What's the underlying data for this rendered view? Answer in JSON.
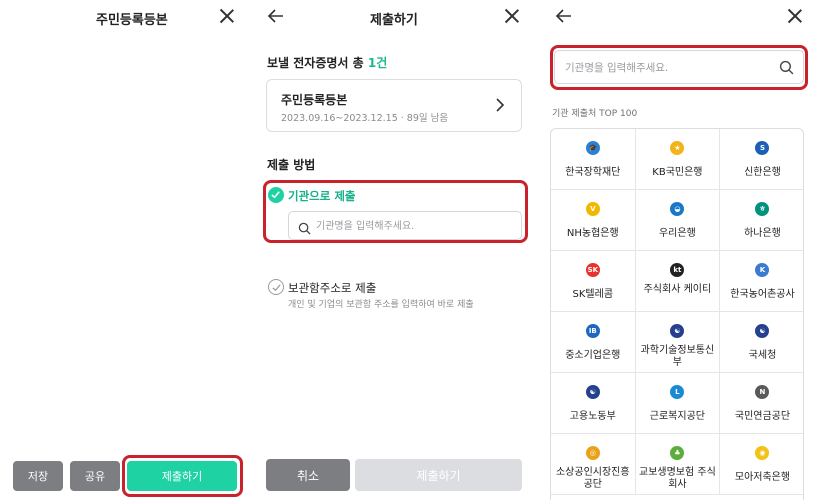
{
  "panel1": {
    "title": "주민등록등본",
    "buttons": {
      "save": "저장",
      "share": "공유",
      "submit": "제출하기"
    }
  },
  "panel2": {
    "title": "제출하기",
    "heading_prefix": "보낼 전자증명서 총 ",
    "heading_count": "1건",
    "doc": {
      "title": "주민등록등본",
      "subtitle": "2023.09.16~2023.12.15 · 89일 남음"
    },
    "method_heading": "제출 방법",
    "option_agency": {
      "label": "기관으로 제출",
      "checked": true
    },
    "search": {
      "placeholder": "기관명을 입력해주세요."
    },
    "option_box": {
      "label": "보관함주소로 제출",
      "desc": "개인 및 기업의 보관함 주소를 입력하여 바로 제출",
      "checked": false
    },
    "buttons": {
      "cancel": "취소",
      "submit": "제출하기"
    }
  },
  "panel3": {
    "search": {
      "placeholder": "기관명을 입력해주세요."
    },
    "grid_label": "기관 제출처 TOP 100",
    "institutions": [
      {
        "name": "한국장학재단",
        "color": "#2d7fd6",
        "glyph": "🎓"
      },
      {
        "name": "KB국민은행",
        "color": "#f3b41b",
        "glyph": "★"
      },
      {
        "name": "신한은행",
        "color": "#1c5fb5",
        "glyph": "S"
      },
      {
        "name": "NH농협은행",
        "color": "#f0b900",
        "glyph": "V"
      },
      {
        "name": "우리은행",
        "color": "#1a78c9",
        "glyph": "◒"
      },
      {
        "name": "하나은행",
        "color": "#00927c",
        "glyph": "ㅎ"
      },
      {
        "name": "SK텔레콤",
        "color": "#e8322d",
        "glyph": "SK"
      },
      {
        "name": "주식회사 케이티",
        "color": "#222222",
        "glyph": "kt"
      },
      {
        "name": "한국농어촌공사",
        "color": "#3a7ccf",
        "glyph": "K"
      },
      {
        "name": "중소기업은행",
        "color": "#1f66c1",
        "glyph": "IB"
      },
      {
        "name": "과학기술정보통신부",
        "color": "#24408e",
        "glyph": "☯"
      },
      {
        "name": "국세청",
        "color": "#24408e",
        "glyph": "☯"
      },
      {
        "name": "고용노동부",
        "color": "#24408e",
        "glyph": "☯"
      },
      {
        "name": "근로복지공단",
        "color": "#1b8ad4",
        "glyph": "L"
      },
      {
        "name": "국민연금공단",
        "color": "#5a5a5a",
        "glyph": "N"
      },
      {
        "name": "소상공인시장진흥공단",
        "color": "#e9a21a",
        "glyph": "◎"
      },
      {
        "name": "교보생명보험 주식회사",
        "color": "#5cae3c",
        "glyph": "♣"
      },
      {
        "name": "모아저축은행",
        "color": "#f2c218",
        "glyph": "◉"
      }
    ]
  }
}
